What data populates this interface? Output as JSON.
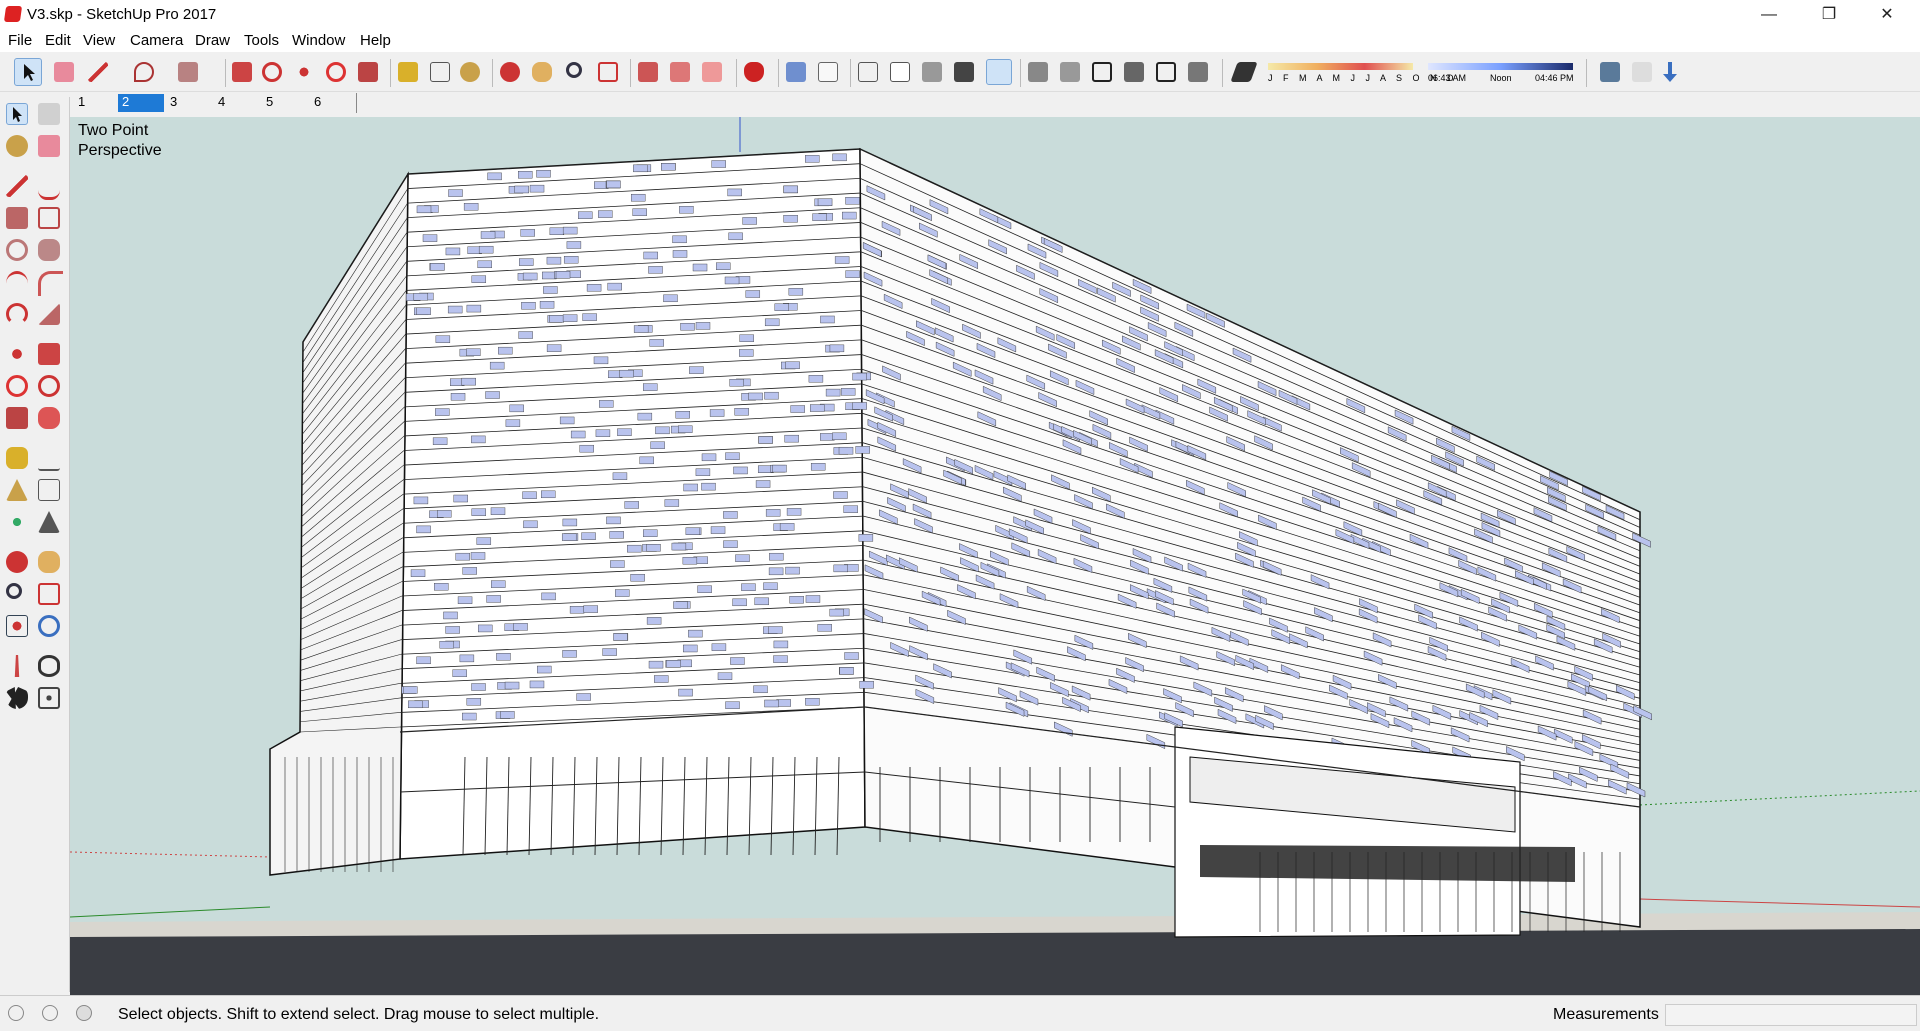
{
  "window": {
    "title": "V3.skp - SketchUp Pro 2017",
    "minimize": "—",
    "restore": "❐",
    "close": "✕"
  },
  "menu": [
    "File",
    "Edit",
    "View",
    "Camera",
    "Draw",
    "Tools",
    "Window",
    "Help"
  ],
  "toolbar": {
    "shadow_months": "J F M A M J J A S O N D",
    "time_start": "06:43 AM",
    "time_noon": "Noon",
    "time_end": "04:46 PM"
  },
  "scenes": [
    "1",
    "2",
    "3",
    "4",
    "5",
    "6"
  ],
  "active_scene": "2",
  "viewport": {
    "camera_label_line1": "Two Point",
    "camera_label_line2": "Perspective"
  },
  "status": {
    "message": "Select objects. Shift to extend select. Drag mouse to select multiple.",
    "measurements_label": "Measurements",
    "measurements_value": ""
  },
  "colors": {
    "sky": "#c9dcda",
    "ground_near": "#3a3d43",
    "ground_far": "#d8d6cf",
    "window_tint": "#b9c3ee",
    "selection": "#1e7ad6"
  }
}
